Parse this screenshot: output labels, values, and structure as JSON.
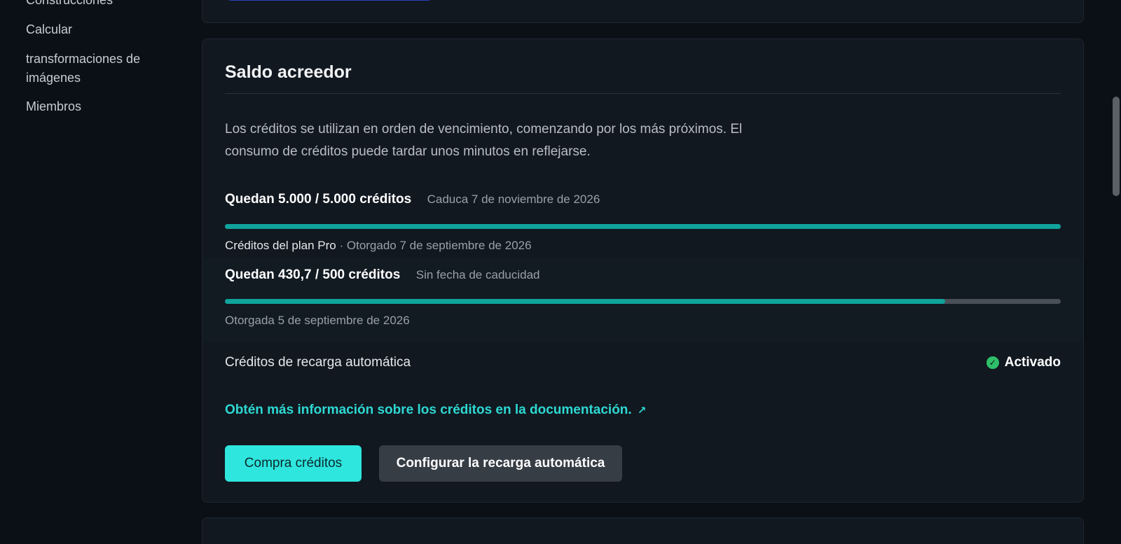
{
  "sidebar": {
    "items": [
      {
        "label": "Construcciones"
      },
      {
        "label": "Calcular"
      },
      {
        "label": "transformaciones de imágenes"
      },
      {
        "label": "Miembros"
      }
    ]
  },
  "credit_balance": {
    "title": "Saldo acreedor",
    "description": "Los créditos se utilizan en orden de vencimiento, comenzando por los más próximos. El consumo de créditos puede tardar unos minutos en reflejarse.",
    "grants": [
      {
        "amount": "Quedan 5.000 / 5.000 créditos",
        "expiry": "Caduca 7 de noviembre de 2026",
        "source": "Créditos del plan Pro",
        "granted": " · Otorgado 7 de septiembre de 2026",
        "remaining_fraction": 1.0
      },
      {
        "amount": "Quedan 430,7 / 500 créditos",
        "expiry": "Sin fecha de caducidad",
        "source": "",
        "granted": "Otorgada 5 de septiembre de 2026",
        "remaining_fraction": 0.8614
      }
    ],
    "auto_reload": {
      "label": "Créditos de recarga automática",
      "status": "Activado",
      "status_icon": "check-circle-icon"
    },
    "doc_link": "Obtén más información sobre los créditos en la documentación.",
    "buttons": {
      "buy": "Compra créditos",
      "configure": "Configurar la recarga automática"
    }
  },
  "colors": {
    "accent": "#2ee6de",
    "progress": "#0fa39c",
    "success": "#2fbf6a",
    "background": "#0b1016"
  }
}
